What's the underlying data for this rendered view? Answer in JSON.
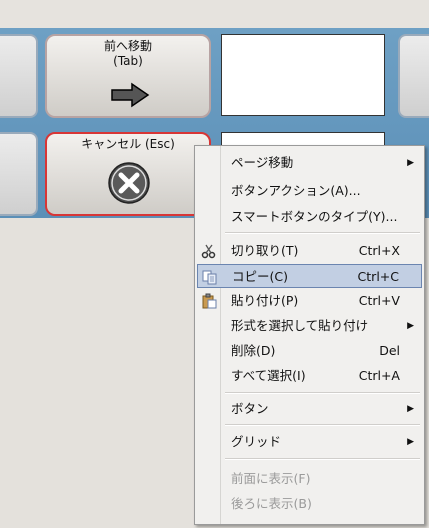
{
  "grid": {
    "button_prev": {
      "label_line1": "前へ移動",
      "label_line2": "(Tab)"
    },
    "button_cancel": {
      "label": "キャンセル (Esc)"
    }
  },
  "context_menu": {
    "items": [
      {
        "label": "ページ移動",
        "shortcut": "",
        "submenu": true,
        "disabled": false
      },
      {
        "label": "ボタンアクション(A)...",
        "shortcut": "",
        "submenu": false,
        "disabled": false
      },
      {
        "label": "スマートボタンのタイプ(Y)...",
        "shortcut": "",
        "submenu": false,
        "disabled": false
      },
      {
        "label": "切り取り(T)",
        "shortcut": "Ctrl+X",
        "submenu": false,
        "disabled": false,
        "icon": "scissors-icon"
      },
      {
        "label": "コピー(C)",
        "shortcut": "Ctrl+C",
        "submenu": false,
        "disabled": false,
        "icon": "copy-icon",
        "highlighted": true
      },
      {
        "label": "貼り付け(P)",
        "shortcut": "Ctrl+V",
        "submenu": false,
        "disabled": false,
        "icon": "paste-icon"
      },
      {
        "label": "形式を選択して貼り付け",
        "shortcut": "",
        "submenu": true,
        "disabled": false
      },
      {
        "label": "削除(D)",
        "shortcut": "Del",
        "submenu": false,
        "disabled": false
      },
      {
        "label": "すべて選択(I)",
        "shortcut": "Ctrl+A",
        "submenu": false,
        "disabled": false
      },
      {
        "label": "ボタン",
        "shortcut": "",
        "submenu": true,
        "disabled": false
      },
      {
        "label": "グリッド",
        "shortcut": "",
        "submenu": true,
        "disabled": false
      },
      {
        "label": "前面に表示(F)",
        "shortcut": "",
        "submenu": false,
        "disabled": true
      },
      {
        "label": "後ろに表示(B)",
        "shortcut": "",
        "submenu": false,
        "disabled": true
      }
    ]
  },
  "colors": {
    "panel_blue": "#5f93ba",
    "selection_red": "#d83636",
    "menu_highlight": "#c2cfe3"
  }
}
